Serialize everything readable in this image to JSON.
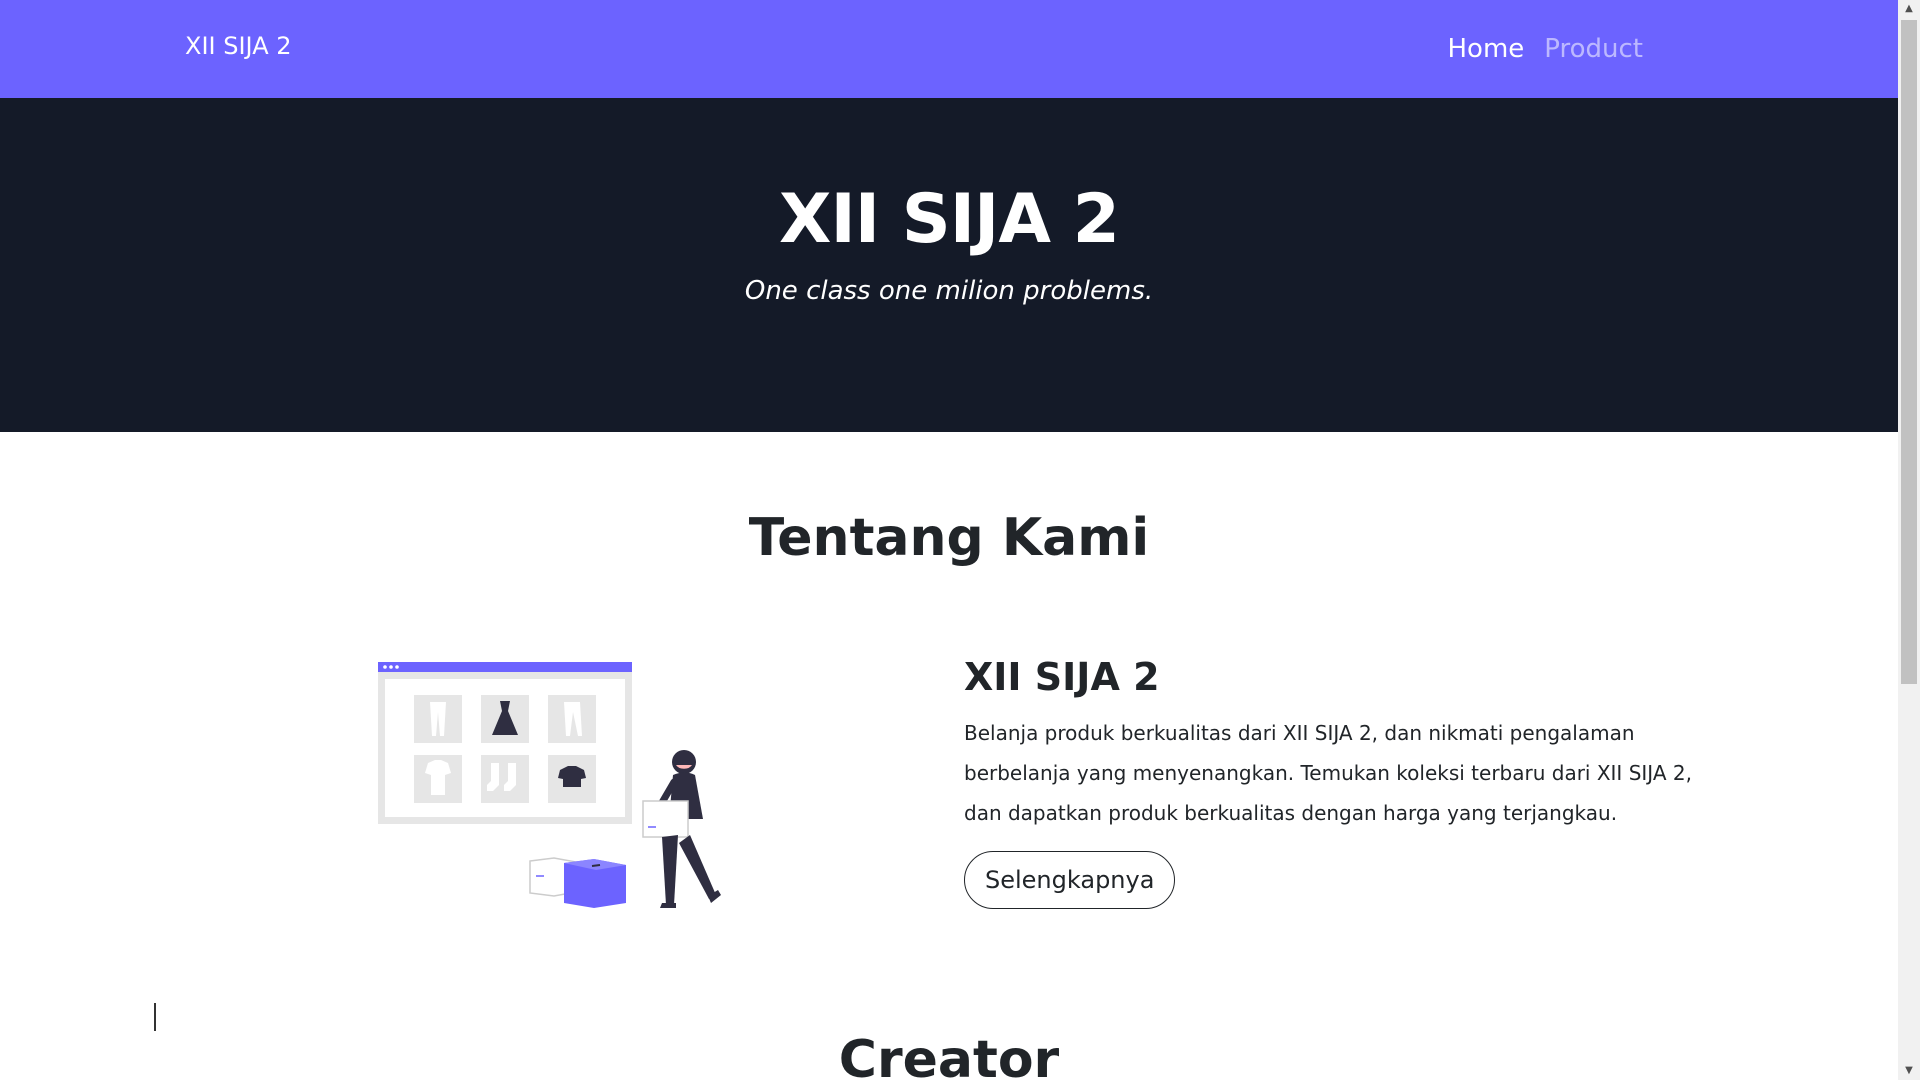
{
  "navbar": {
    "brand": "XII SIJA 2",
    "links": [
      {
        "label": "Home",
        "active": true
      },
      {
        "label": "Product",
        "active": false
      }
    ],
    "bg_color": "#6c63ff"
  },
  "hero": {
    "title": "XII SIJA 2",
    "tagline": "One class one milion problems.",
    "bg_color": "#141a28"
  },
  "about": {
    "section_title": "Tentang Kami",
    "heading": "XII SIJA 2",
    "description": "Belanja produk berkualitas dari XII SIJA 2, dan nikmati pengalaman berbelanja yang menyenangkan. Temukan koleksi terbaru dari XII SIJA 2, dan dapatkan produk berkualitas dengan harga yang terjangkau.",
    "button_label": "Selengkapnya",
    "illustration_icon": "online-shopping-illustration"
  },
  "creator": {
    "section_title": "Creator"
  },
  "scrollbar": {
    "up_icon": "▲",
    "down_icon": "▼"
  }
}
